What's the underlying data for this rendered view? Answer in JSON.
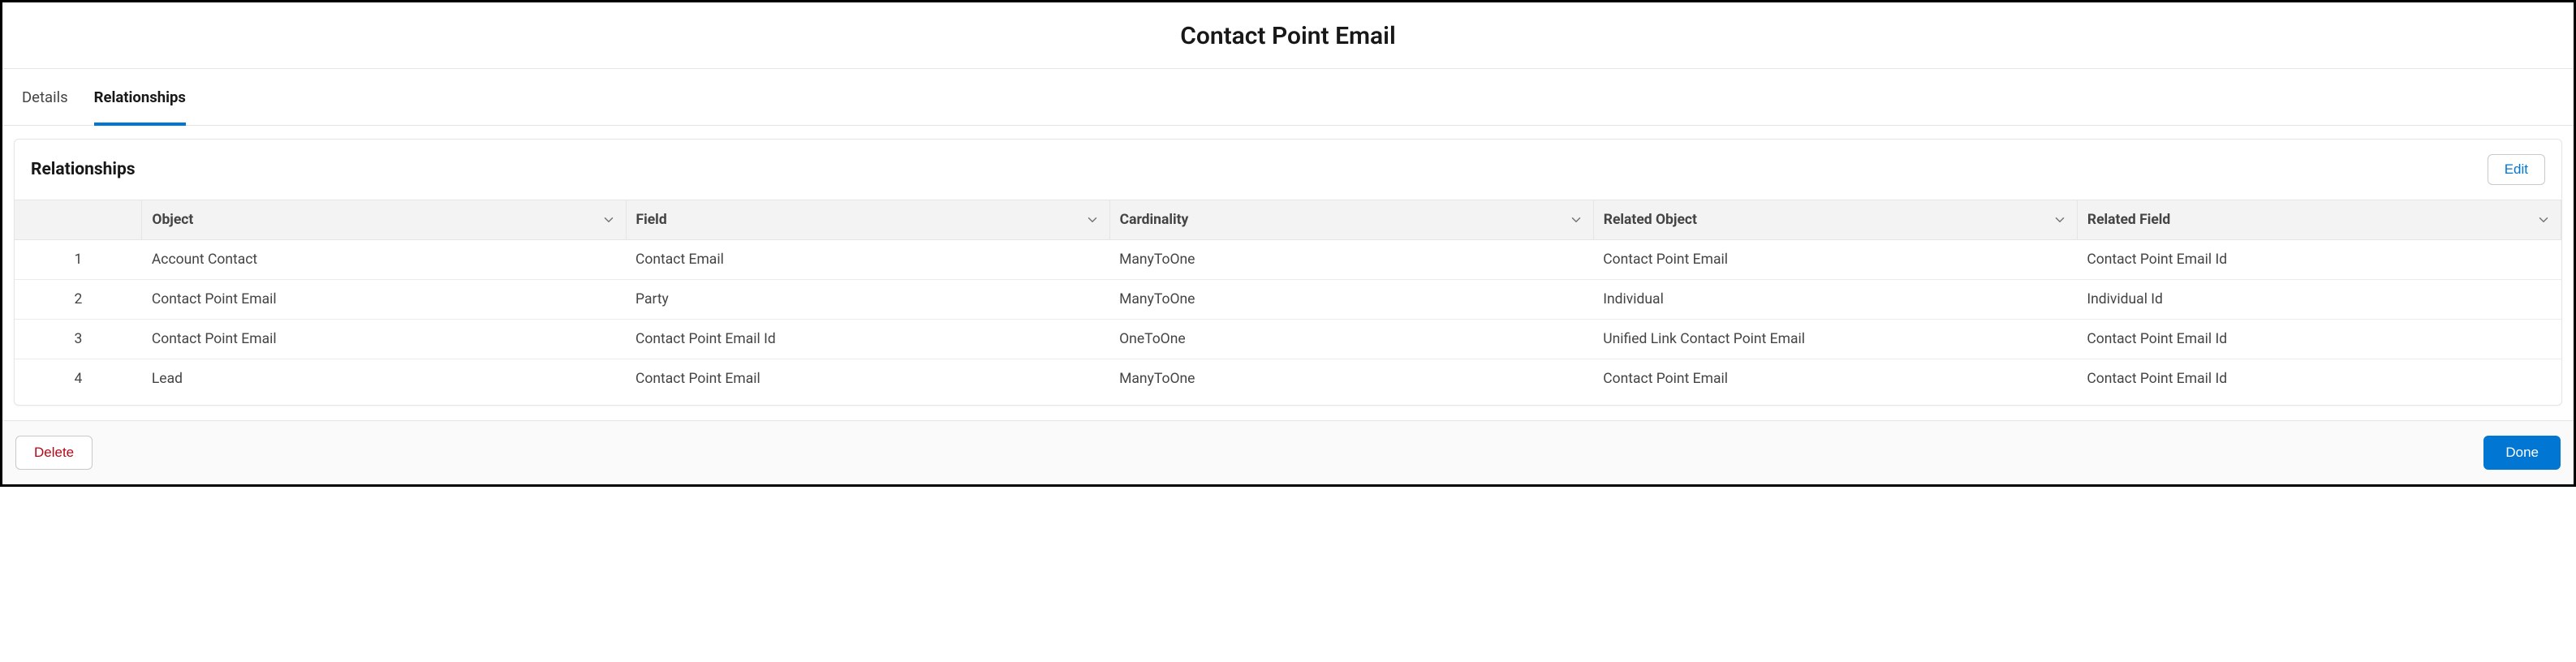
{
  "header": {
    "title": "Contact Point Email"
  },
  "tabs": {
    "details": "Details",
    "relationships": "Relationships",
    "active": "relationships"
  },
  "panel": {
    "title": "Relationships",
    "edit_label": "Edit"
  },
  "columns": {
    "object": "Object",
    "field": "Field",
    "cardinality": "Cardinality",
    "related_object": "Related Object",
    "related_field": "Related Field"
  },
  "rows": [
    {
      "n": "1",
      "object": "Account Contact",
      "field": "Contact Email",
      "cardinality": "ManyToOne",
      "related_object": "Contact Point Email",
      "related_field": "Contact Point Email Id"
    },
    {
      "n": "2",
      "object": "Contact Point Email",
      "field": "Party",
      "cardinality": "ManyToOne",
      "related_object": "Individual",
      "related_field": "Individual Id"
    },
    {
      "n": "3",
      "object": "Contact Point Email",
      "field": "Contact Point Email Id",
      "cardinality": "OneToOne",
      "related_object": "Unified Link Contact Point Email",
      "related_field": "Contact Point Email Id"
    },
    {
      "n": "4",
      "object": "Lead",
      "field": "Contact Point Email",
      "cardinality": "ManyToOne",
      "related_object": "Contact Point Email",
      "related_field": "Contact Point Email Id"
    }
  ],
  "footer": {
    "delete_label": "Delete",
    "done_label": "Done"
  }
}
